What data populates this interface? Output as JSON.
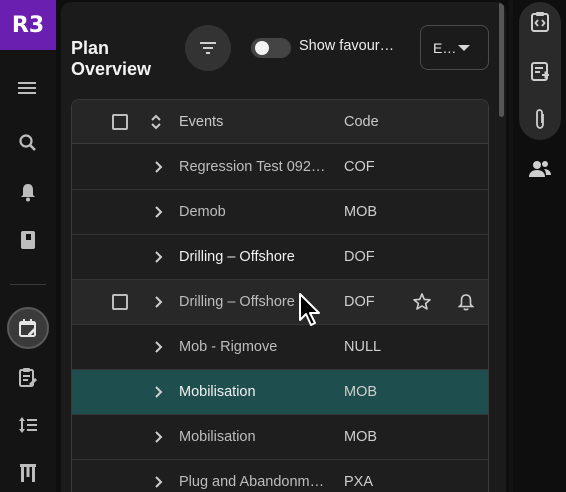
{
  "app": {
    "logo_text": "R3",
    "brand_color": "#6a1fb0"
  },
  "rail": {
    "icons": [
      "menu-icon",
      "search-icon",
      "bell-icon",
      "book-icon",
      "calendar-edit-icon",
      "clipboard-edit-icon",
      "sort-list-icon",
      "tool-icon"
    ],
    "active": "calendar-edit-icon"
  },
  "header": {
    "title_line1": "Plan",
    "title_line2": "Overview",
    "toggle_label": "Show favour…",
    "select_value": "E…"
  },
  "table": {
    "columns": {
      "events": "Events",
      "code": "Code"
    },
    "rows": [
      {
        "event": "Regression Test 092…",
        "code": "COF",
        "state": "normal",
        "bright": false
      },
      {
        "event": "Demob",
        "code": "MOB",
        "state": "normal",
        "bright": false
      },
      {
        "event": "Drilling – Offshore",
        "code": "DOF",
        "state": "normal",
        "bright": true
      },
      {
        "event": "Drilling – Offshore",
        "code": "DOF",
        "state": "hover",
        "bright": false
      },
      {
        "event": "Mob - Rigmove",
        "code": "NULL",
        "state": "normal",
        "bright": false
      },
      {
        "event": "Mobilisation",
        "code": "MOB",
        "state": "selected",
        "bright": false
      },
      {
        "event": "Mobilisation",
        "code": "MOB",
        "state": "normal",
        "bright": false
      },
      {
        "event": "Plug and Abandonm…",
        "code": "PXA",
        "state": "normal",
        "bright": false
      }
    ],
    "selected_color": "#1f4e4f"
  },
  "right_rail": {
    "icons": [
      "code-clipboard-icon",
      "add-list-icon",
      "attachment-icon",
      "users-icon"
    ]
  }
}
